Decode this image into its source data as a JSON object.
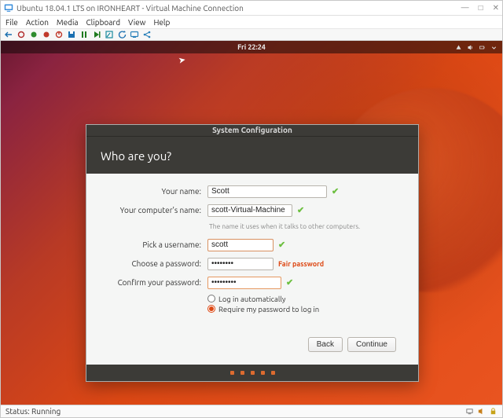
{
  "window": {
    "title": "Ubuntu 18.04.1 LTS on IRONHEART - Virtual Machine Connection",
    "min_icon": "—",
    "max_icon": "□",
    "close_icon": "✕"
  },
  "menubar": [
    "File",
    "Action",
    "Media",
    "Clipboard",
    "View",
    "Help"
  ],
  "toolbar_icons": {
    "nav_back": "chevron-left",
    "record": "record",
    "record2": "record-alt",
    "stop": "stop",
    "save": "save",
    "pause": "pause",
    "play": "play",
    "snapshot": "snapshot",
    "revert": "revert",
    "enhanced": "enhanced",
    "share": "share"
  },
  "ubuntu_topbar": {
    "clock": "Fri 22:24",
    "tray": [
      "network-icon",
      "volume-icon",
      "power-icon",
      "menu-icon"
    ]
  },
  "installer": {
    "window_title": "System Configuration",
    "heading": "Who are you?",
    "labels": {
      "name": "Your name:",
      "computer": "Your computer's name:",
      "computer_hint": "The name it uses when it talks to other computers.",
      "username": "Pick a username:",
      "password": "Choose a password:",
      "confirm": "Confirm your password:"
    },
    "values": {
      "name": "Scott",
      "computer": "scott-Virtual-Machine",
      "username": "scott",
      "password": "••••••••",
      "confirm": "•••••••••"
    },
    "password_strength": "Fair password",
    "radios": {
      "auto": "Log in automatically",
      "require": "Require my password to log in"
    },
    "buttons": {
      "back": "Back",
      "continue": "Continue"
    }
  },
  "statusbar": {
    "status": "Status: Running"
  }
}
